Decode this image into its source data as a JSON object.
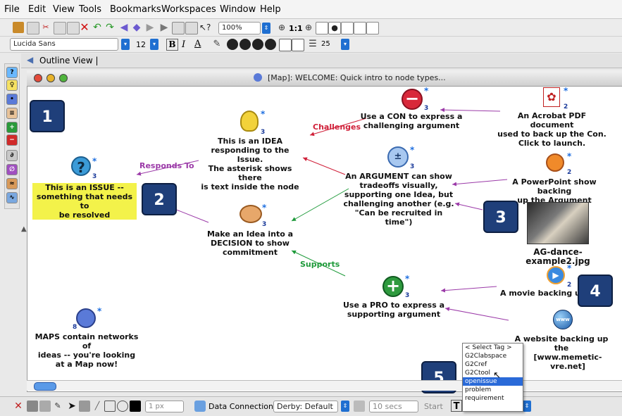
{
  "menu": [
    "File",
    "Edit",
    "View",
    "Tools",
    "Bookmarks",
    "Workspaces",
    "Window",
    "Help"
  ],
  "format_toolbar": {
    "zoom": "100%",
    "zoom_fit": "1:1",
    "font": "Lucida Sans",
    "font_size": "12",
    "bold": "B",
    "italic": "I",
    "underline": "A",
    "line_width": "25"
  },
  "outline_view": "Outline View |",
  "window_title": "[Map]: WELCOME: Quick intro to node types...",
  "badges": [
    "1",
    "2",
    "3",
    "4",
    "5"
  ],
  "nodes": {
    "issue": {
      "count": "3",
      "text": [
        "This is an ISSUE --",
        "something that needs to",
        "be resolved"
      ]
    },
    "idea": {
      "count": "3",
      "text": [
        "This is an IDEA",
        "responding to the Issue.",
        "The asterisk shows there",
        "is text inside the node"
      ]
    },
    "con": {
      "count": "3",
      "text": [
        "Use a CON to express a",
        "challenging argument"
      ]
    },
    "argument": {
      "count": "3",
      "text": [
        "An ARGUMENT can show",
        "tradeoffs visually,",
        "supporting one Idea, but",
        "challenging another (e.g.",
        "\"Can be recruited in",
        "time\")"
      ]
    },
    "decision": {
      "count": "3",
      "text": [
        "Make an Idea into a",
        "DECISION to show",
        "commitment"
      ]
    },
    "pro": {
      "count": "3",
      "text": [
        "Use a PRO to express a",
        "supporting argument"
      ]
    },
    "map": {
      "count": "8",
      "text": [
        "MAPS contain networks of",
        "ideas -- you're looking",
        "at a Map now!"
      ]
    },
    "pdf": {
      "count": "2",
      "text": [
        "An Acrobat PDF document",
        "used to back up the Con.",
        "Click to launch."
      ]
    },
    "ppt": {
      "count": "2",
      "text": [
        "A PowerPoint show backing",
        "up the Argument"
      ]
    },
    "image": {
      "text": [
        "AG-dance-example2.jpg"
      ]
    },
    "movie": {
      "count": "2",
      "text": [
        "A movie backing u"
      ]
    },
    "website": {
      "text": [
        "A website backing up the",
        "[www.memetic-vre.net]"
      ]
    }
  },
  "links": {
    "challenges": "Challenges",
    "responds_to": "Responds To",
    "supports": "Supports"
  },
  "colors": {
    "challenges": "#d0213a",
    "responds": "#9b3aa8",
    "supports": "#1e9a3a",
    "badge": "#1f3f7a",
    "issue_highlight": "#f3f24a"
  },
  "bottom_toolbar": {
    "line_size": "1 px",
    "data_connection_label": "Data Connection:",
    "data_connection_value": "Derby: Default",
    "interval": "10 secs",
    "start": "Start"
  },
  "tag_dropdown": {
    "options": [
      "< Select Tag >",
      "G2Clabspace",
      "G2Cref",
      "G2Ctool",
      "openissue",
      "problem",
      "requirement"
    ],
    "selected": "openissue"
  }
}
